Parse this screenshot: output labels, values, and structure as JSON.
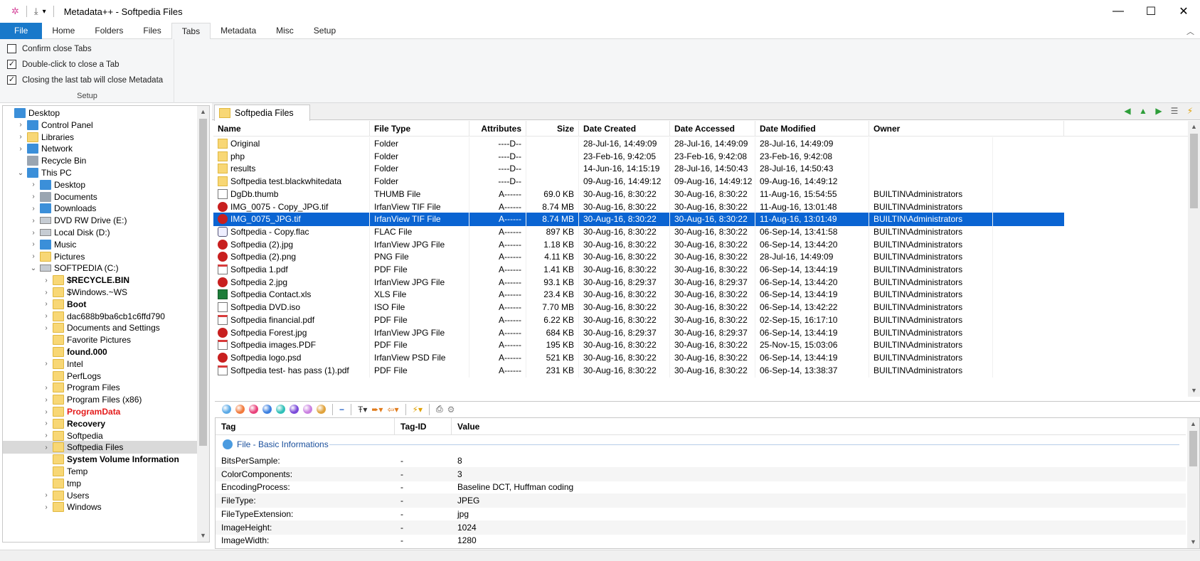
{
  "window": {
    "app_title": "Metadata++ - Softpedia Files",
    "controls": {
      "minimize": "—",
      "maximize": "☐",
      "close": "✕"
    }
  },
  "ribbon": {
    "tabs": [
      "File",
      "Home",
      "Folders",
      "Files",
      "Tabs",
      "Metadata",
      "Misc",
      "Setup"
    ],
    "active_tab": "Tabs",
    "options": [
      {
        "label": "Confirm close Tabs",
        "checked": false
      },
      {
        "label": "Double-click to close a Tab",
        "checked": true
      },
      {
        "label": "Closing the last tab will close Metadata",
        "checked": true
      }
    ],
    "group_label": "Setup"
  },
  "tree": {
    "items": [
      {
        "label": "Desktop",
        "level": 0,
        "expand": "",
        "icon": "desktop-icon",
        "style": ""
      },
      {
        "label": "Control Panel",
        "level": 1,
        "expand": ">",
        "icon": "control-panel-icon",
        "style": ""
      },
      {
        "label": "Libraries",
        "level": 1,
        "expand": ">",
        "icon": "libraries-icon",
        "style": ""
      },
      {
        "label": "Network",
        "level": 1,
        "expand": ">",
        "icon": "network-icon",
        "style": ""
      },
      {
        "label": "Recycle Bin",
        "level": 1,
        "expand": "",
        "icon": "recycle-bin-icon",
        "style": ""
      },
      {
        "label": "This PC",
        "level": 1,
        "expand": "v",
        "icon": "computer-icon",
        "style": ""
      },
      {
        "label": "Desktop",
        "level": 2,
        "expand": ">",
        "icon": "desktop-icon",
        "style": ""
      },
      {
        "label": "Documents",
        "level": 2,
        "expand": ">",
        "icon": "documents-icon",
        "style": ""
      },
      {
        "label": "Downloads",
        "level": 2,
        "expand": ">",
        "icon": "downloads-icon",
        "style": ""
      },
      {
        "label": "DVD RW Drive (E:)",
        "level": 2,
        "expand": ">",
        "icon": "dvd-drive-icon",
        "style": ""
      },
      {
        "label": "Local Disk (D:)",
        "level": 2,
        "expand": ">",
        "icon": "drive-icon",
        "style": ""
      },
      {
        "label": "Music",
        "level": 2,
        "expand": ">",
        "icon": "music-icon",
        "style": ""
      },
      {
        "label": "Pictures",
        "level": 2,
        "expand": ">",
        "icon": "pictures-icon",
        "style": ""
      },
      {
        "label": "SOFTPEDIA (C:)",
        "level": 2,
        "expand": "v",
        "icon": "drive-icon",
        "style": ""
      },
      {
        "label": "$RECYCLE.BIN",
        "level": 3,
        "expand": ">",
        "icon": "folder-icon",
        "style": "bold"
      },
      {
        "label": "$Windows.~WS",
        "level": 3,
        "expand": ">",
        "icon": "folder-icon",
        "style": ""
      },
      {
        "label": "Boot",
        "level": 3,
        "expand": ">",
        "icon": "folder-icon",
        "style": "bold"
      },
      {
        "label": "dac688b9ba6cb1c6ffd790",
        "level": 3,
        "expand": ">",
        "icon": "folder-icon",
        "style": ""
      },
      {
        "label": "Documents and Settings",
        "level": 3,
        "expand": ">",
        "icon": "folder-shortcut-icon",
        "style": ""
      },
      {
        "label": "Favorite Pictures",
        "level": 3,
        "expand": "",
        "icon": "folder-icon",
        "style": ""
      },
      {
        "label": "found.000",
        "level": 3,
        "expand": "",
        "icon": "folder-icon",
        "style": "bold"
      },
      {
        "label": "Intel",
        "level": 3,
        "expand": ">",
        "icon": "folder-icon",
        "style": ""
      },
      {
        "label": "PerfLogs",
        "level": 3,
        "expand": "",
        "icon": "folder-icon",
        "style": ""
      },
      {
        "label": "Program Files",
        "level": 3,
        "expand": ">",
        "icon": "folder-icon",
        "style": ""
      },
      {
        "label": "Program Files (x86)",
        "level": 3,
        "expand": ">",
        "icon": "folder-icon",
        "style": ""
      },
      {
        "label": "ProgramData",
        "level": 3,
        "expand": ">",
        "icon": "folder-icon",
        "style": "red"
      },
      {
        "label": "Recovery",
        "level": 3,
        "expand": ">",
        "icon": "folder-icon",
        "style": "bold"
      },
      {
        "label": "Softpedia",
        "level": 3,
        "expand": ">",
        "icon": "folder-icon",
        "style": ""
      },
      {
        "label": "Softpedia Files",
        "level": 3,
        "expand": ">",
        "icon": "folder-icon",
        "style": "selected"
      },
      {
        "label": "System Volume Information",
        "level": 3,
        "expand": "",
        "icon": "folder-icon",
        "style": "bold"
      },
      {
        "label": "Temp",
        "level": 3,
        "expand": "",
        "icon": "folder-icon",
        "style": ""
      },
      {
        "label": "tmp",
        "level": 3,
        "expand": "",
        "icon": "folder-icon",
        "style": ""
      },
      {
        "label": "Users",
        "level": 3,
        "expand": ">",
        "icon": "folder-icon",
        "style": ""
      },
      {
        "label": "Windows",
        "level": 3,
        "expand": ">",
        "icon": "folder-icon",
        "style": ""
      }
    ]
  },
  "folder_tab": {
    "label": "Softpedia Files"
  },
  "file_list": {
    "columns": [
      "Name",
      "File Type",
      "Attributes",
      "Size",
      "Date Created",
      "Date Accessed",
      "Date Modified",
      "Owner"
    ],
    "rows": [
      {
        "name": "Original",
        "type": "Folder",
        "attr": "----D--",
        "size": "",
        "created": "28-Jul-16, 14:49:09",
        "accessed": "28-Jul-16, 14:49:09",
        "modified": "28-Jul-16, 14:49:09",
        "owner": "",
        "icon": "folder"
      },
      {
        "name": "php",
        "type": "Folder",
        "attr": "----D--",
        "size": "",
        "created": "23-Feb-16, 9:42:05",
        "accessed": "23-Feb-16, 9:42:08",
        "modified": "23-Feb-16, 9:42:08",
        "owner": "",
        "icon": "folder"
      },
      {
        "name": "results",
        "type": "Folder",
        "attr": "----D--",
        "size": "",
        "created": "14-Jun-16, 14:15:19",
        "accessed": "28-Jul-16, 14:50:43",
        "modified": "28-Jul-16, 14:50:43",
        "owner": "",
        "icon": "folder"
      },
      {
        "name": "Softpedia test.blackwhitedata",
        "type": "Folder",
        "attr": "----D--",
        "size": "",
        "created": "09-Aug-16, 14:49:12",
        "accessed": "09-Aug-16, 14:49:12",
        "modified": "09-Aug-16, 14:49:12",
        "owner": "",
        "icon": "folder"
      },
      {
        "name": "DgDb.thumb",
        "type": "THUMB File",
        "attr": "A------",
        "size": "69.0 KB",
        "created": "30-Aug-16, 8:30:22",
        "accessed": "30-Aug-16, 8:30:22",
        "modified": "11-Aug-16, 15:54:55",
        "owner": "BUILTIN\\Administrators",
        "icon": "doc"
      },
      {
        "name": "IMG_0075 - Copy_JPG.tif",
        "type": "IrfanView TIF File",
        "attr": "A------",
        "size": "8.74 MB",
        "created": "30-Aug-16, 8:30:22",
        "accessed": "30-Aug-16, 8:30:22",
        "modified": "11-Aug-16, 13:01:48",
        "owner": "BUILTIN\\Administrators",
        "icon": "irfan"
      },
      {
        "name": "IMG_0075_JPG.tif",
        "type": "IrfanView TIF File",
        "attr": "A------",
        "size": "8.74 MB",
        "created": "30-Aug-16, 8:30:22",
        "accessed": "30-Aug-16, 8:30:22",
        "modified": "11-Aug-16, 13:01:49",
        "owner": "BUILTIN\\Administrators",
        "icon": "irfan",
        "selected": true
      },
      {
        "name": "Softpedia - Copy.flac",
        "type": "FLAC File",
        "attr": "A------",
        "size": "897 KB",
        "created": "30-Aug-16, 8:30:22",
        "accessed": "30-Aug-16, 8:30:22",
        "modified": "06-Sep-14, 13:41:58",
        "owner": "BUILTIN\\Administrators",
        "icon": "flac"
      },
      {
        "name": "Softpedia (2).jpg",
        "type": "IrfanView JPG File",
        "attr": "A------",
        "size": "1.18 KB",
        "created": "30-Aug-16, 8:30:22",
        "accessed": "30-Aug-16, 8:30:22",
        "modified": "06-Sep-14, 13:44:20",
        "owner": "BUILTIN\\Administrators",
        "icon": "irfan"
      },
      {
        "name": "Softpedia (2).png",
        "type": "PNG File",
        "attr": "A------",
        "size": "4.11 KB",
        "created": "30-Aug-16, 8:30:22",
        "accessed": "30-Aug-16, 8:30:22",
        "modified": "28-Jul-16, 14:49:09",
        "owner": "BUILTIN\\Administrators",
        "icon": "irfan"
      },
      {
        "name": "Softpedia 1.pdf",
        "type": "PDF File",
        "attr": "A------",
        "size": "1.41 KB",
        "created": "30-Aug-16, 8:30:22",
        "accessed": "30-Aug-16, 8:30:22",
        "modified": "06-Sep-14, 13:44:19",
        "owner": "BUILTIN\\Administrators",
        "icon": "pdf"
      },
      {
        "name": "Softpedia 2.jpg",
        "type": "IrfanView JPG File",
        "attr": "A------",
        "size": "93.1 KB",
        "created": "30-Aug-16, 8:29:37",
        "accessed": "30-Aug-16, 8:29:37",
        "modified": "06-Sep-14, 13:44:20",
        "owner": "BUILTIN\\Administrators",
        "icon": "irfan"
      },
      {
        "name": "Softpedia Contact.xls",
        "type": "XLS File",
        "attr": "A------",
        "size": "23.4 KB",
        "created": "30-Aug-16, 8:30:22",
        "accessed": "30-Aug-16, 8:30:22",
        "modified": "06-Sep-14, 13:44:19",
        "owner": "BUILTIN\\Administrators",
        "icon": "xls"
      },
      {
        "name": "Softpedia DVD.iso",
        "type": "ISO File",
        "attr": "A------",
        "size": "7.70 MB",
        "created": "30-Aug-16, 8:30:22",
        "accessed": "30-Aug-16, 8:30:22",
        "modified": "06-Sep-14, 13:42:22",
        "owner": "BUILTIN\\Administrators",
        "icon": "doc"
      },
      {
        "name": "Softpedia financial.pdf",
        "type": "PDF File",
        "attr": "A------",
        "size": "6.22 KB",
        "created": "30-Aug-16, 8:30:22",
        "accessed": "30-Aug-16, 8:30:22",
        "modified": "02-Sep-15, 16:17:10",
        "owner": "BUILTIN\\Administrators",
        "icon": "pdf"
      },
      {
        "name": "Softpedia Forest.jpg",
        "type": "IrfanView JPG File",
        "attr": "A------",
        "size": "684 KB",
        "created": "30-Aug-16, 8:29:37",
        "accessed": "30-Aug-16, 8:29:37",
        "modified": "06-Sep-14, 13:44:19",
        "owner": "BUILTIN\\Administrators",
        "icon": "irfan"
      },
      {
        "name": "Softpedia images.PDF",
        "type": "PDF File",
        "attr": "A------",
        "size": "195 KB",
        "created": "30-Aug-16, 8:30:22",
        "accessed": "30-Aug-16, 8:30:22",
        "modified": "25-Nov-15, 15:03:06",
        "owner": "BUILTIN\\Administrators",
        "icon": "pdf"
      },
      {
        "name": "Softpedia logo.psd",
        "type": "IrfanView PSD File",
        "attr": "A------",
        "size": "521 KB",
        "created": "30-Aug-16, 8:30:22",
        "accessed": "30-Aug-16, 8:30:22",
        "modified": "06-Sep-14, 13:44:19",
        "owner": "BUILTIN\\Administrators",
        "icon": "irfan"
      },
      {
        "name": "Softpedia test- has pass (1).pdf",
        "type": "PDF File",
        "attr": "A------",
        "size": "231 KB",
        "created": "30-Aug-16, 8:30:22",
        "accessed": "30-Aug-16, 8:30:22",
        "modified": "06-Sep-14, 13:38:37",
        "owner": "BUILTIN\\Administrators",
        "icon": "pdf"
      }
    ]
  },
  "metadata_toolbar": {
    "dot_colors": [
      "#5aa9e6",
      "#f27a3c",
      "#e8417a",
      "#3b7fe0",
      "#2fc0b8",
      "#7a49d9",
      "#c97fe0",
      "#e0a23b"
    ],
    "minus_label": "−"
  },
  "tag_panel": {
    "columns": [
      "Tag",
      "Tag-ID",
      "Value"
    ],
    "group_label": "File - Basic Informations",
    "rows": [
      {
        "tag": "BitsPerSample:",
        "id": "-",
        "value": "8"
      },
      {
        "tag": "ColorComponents:",
        "id": "-",
        "value": "3"
      },
      {
        "tag": "EncodingProcess:",
        "id": "-",
        "value": "Baseline DCT, Huffman coding"
      },
      {
        "tag": "FileType:",
        "id": "-",
        "value": "JPEG"
      },
      {
        "tag": "FileTypeExtension:",
        "id": "-",
        "value": "jpg"
      },
      {
        "tag": "ImageHeight:",
        "id": "-",
        "value": "1024"
      },
      {
        "tag": "ImageWidth:",
        "id": "-",
        "value": "1280"
      }
    ]
  }
}
